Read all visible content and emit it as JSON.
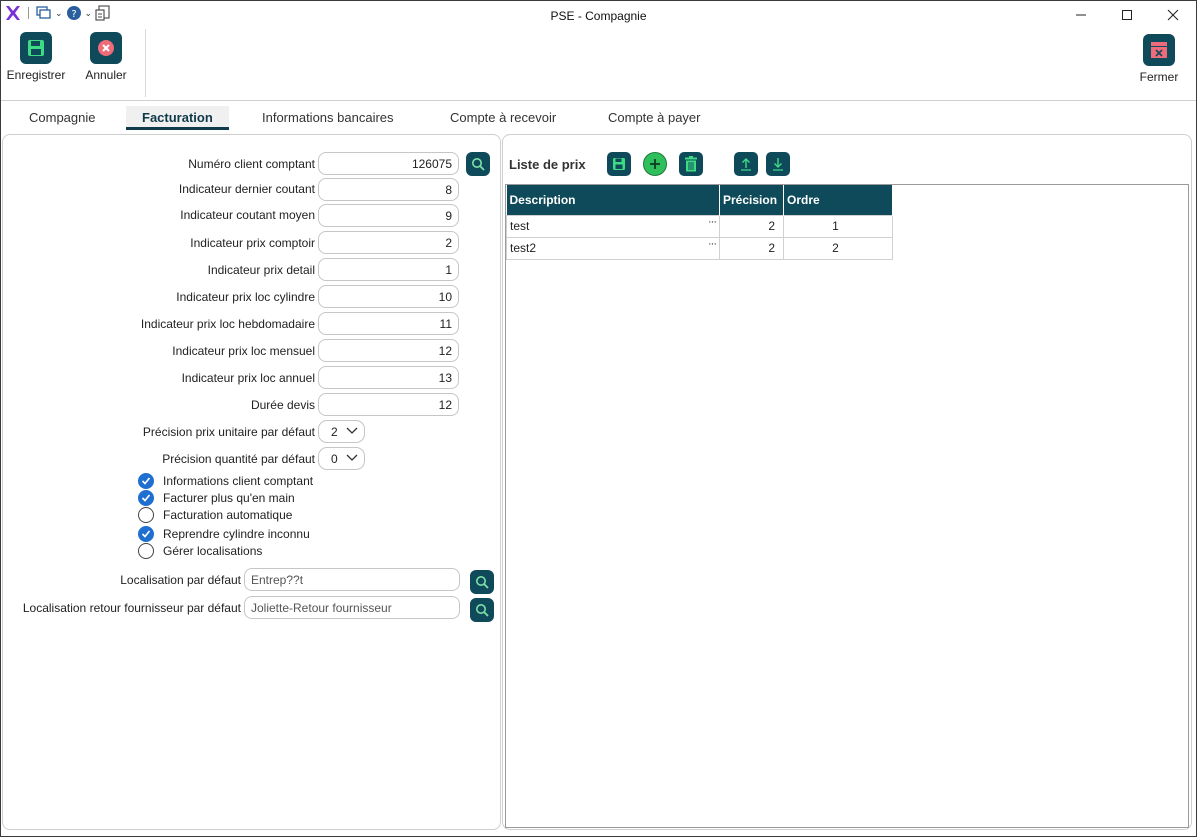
{
  "window": {
    "title": "PSE - Compagnie"
  },
  "ribbon": {
    "save_label": "Enregistrer",
    "cancel_label": "Annuler",
    "close_label": "Fermer"
  },
  "tabs": [
    {
      "label": "Compagnie"
    },
    {
      "label": "Facturation",
      "active": true
    },
    {
      "label": "Informations bancaires"
    },
    {
      "label": "Compte à recevoir"
    },
    {
      "label": "Compte à payer"
    }
  ],
  "form": {
    "fields": [
      {
        "label": "Numéro client comptant",
        "value": "126075"
      },
      {
        "label": "Indicateur  dernier coutant",
        "value": "8"
      },
      {
        "label": "Indicateur coutant moyen",
        "value": "9"
      },
      {
        "label": "Indicateur prix comptoir",
        "value": "2"
      },
      {
        "label": "Indicateur prix detail",
        "value": "1"
      },
      {
        "label": "Indicateur prix loc cylindre",
        "value": "10"
      },
      {
        "label": "Indicateur prix loc hebdomadaire",
        "value": "11"
      },
      {
        "label": "Indicateur prix loc mensuel",
        "value": "12"
      },
      {
        "label": "Indicateur prix loc annuel",
        "value": "13"
      },
      {
        "label": "Durée devis",
        "value": "12"
      }
    ],
    "selects": [
      {
        "label": "Précision prix unitaire par défaut",
        "value": "2"
      },
      {
        "label": "Précision quantité par défaut",
        "value": "0"
      }
    ],
    "checkboxes": [
      {
        "label": "Informations client comptant",
        "checked": true
      },
      {
        "label": "Facturer plus qu'en main",
        "checked": true
      },
      {
        "label": "Facturation automatique",
        "checked": false
      },
      {
        "label": "Reprendre cylindre inconnu",
        "checked": true
      },
      {
        "label": "Gérer localisations",
        "checked": false
      }
    ],
    "locations": [
      {
        "label": "Localisation par défaut",
        "value": "Entrep??t"
      },
      {
        "label": "Localisation retour fournisseur par défaut",
        "value": "Joliette-Retour fournisseur"
      }
    ]
  },
  "price_list": {
    "title": "Liste de prix",
    "columns": [
      "Description",
      "Précision",
      "Ordre"
    ],
    "rows": [
      {
        "description": "test",
        "precision": "2",
        "ordre": "1"
      },
      {
        "description": "test2",
        "precision": "2",
        "ordre": "2"
      }
    ]
  },
  "colors": {
    "accent": "#0f4a5a",
    "checkbox": "#1e6fd0",
    "add_green": "#2fbf5d"
  }
}
